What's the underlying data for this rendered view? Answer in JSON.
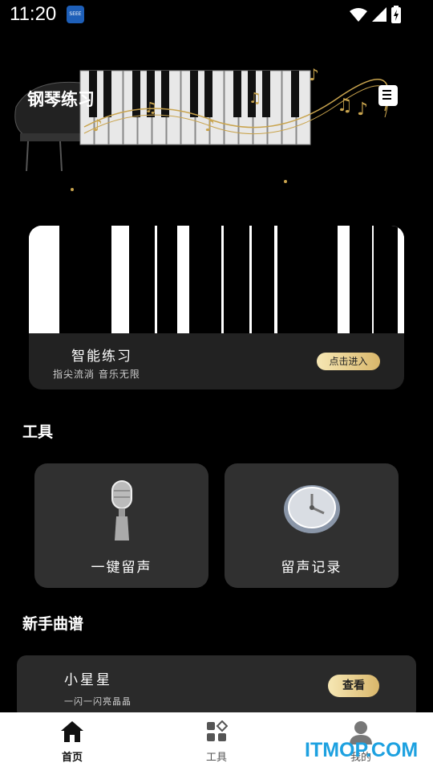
{
  "status": {
    "time": "11:20",
    "app_icon_text": "SEEE"
  },
  "header": {
    "title": "钢琴练习"
  },
  "practice": {
    "title": "智能练习",
    "subtitle": "指尖流淌  音乐无限",
    "enter_label": "点击进入"
  },
  "tools": {
    "section_title": "工具",
    "items": [
      {
        "label": "一键留声",
        "icon": "microphone-icon"
      },
      {
        "label": "留声记录",
        "icon": "clock-icon"
      }
    ]
  },
  "scores": {
    "section_title": "新手曲谱",
    "items": [
      {
        "title": "小星星",
        "subtitle": "一闪一闪亮晶晶",
        "view_label": "查看"
      }
    ]
  },
  "nav": {
    "items": [
      {
        "label": "首页",
        "icon": "home-icon"
      },
      {
        "label": "工具",
        "icon": "grid-icon"
      },
      {
        "label": "我的",
        "icon": "user-icon"
      }
    ]
  },
  "watermark": "ITMOP.COM",
  "colors": {
    "accent_gold": "#e3c47d",
    "card_bg": "#303030",
    "watermark": "#1da1e0"
  }
}
